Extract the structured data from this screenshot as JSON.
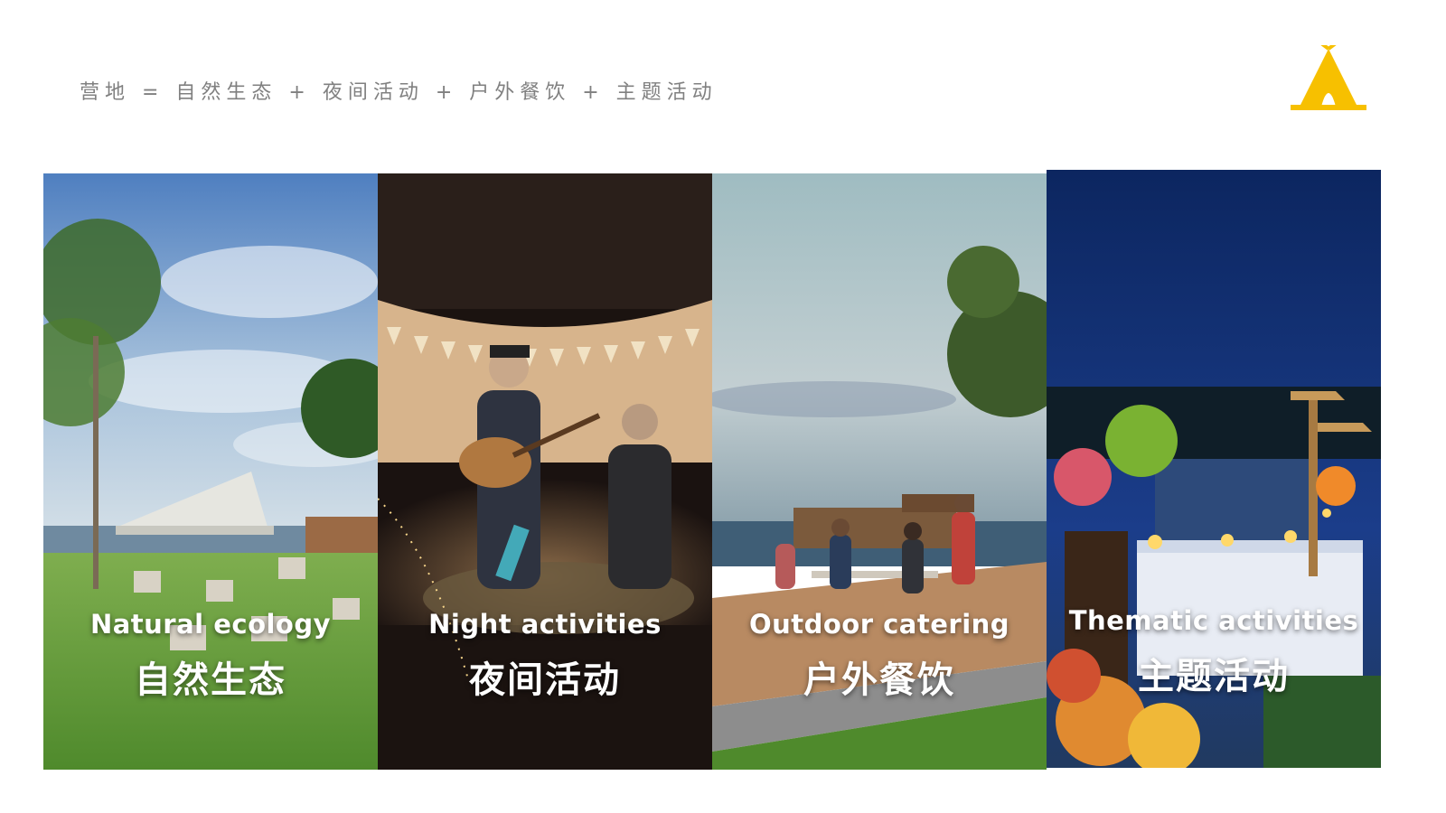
{
  "header": {
    "title": "营地 = 自然生态 + 夜间活动 + 户外餐饮 + 主题活动",
    "logo_icon": "tent-icon",
    "logo_color": "#F7C000"
  },
  "panels": [
    {
      "caption_en": "Natural ecology",
      "caption_zh": "自然生态"
    },
    {
      "caption_en": "Night activities",
      "caption_zh": "夜间活动"
    },
    {
      "caption_en": "Outdoor catering",
      "caption_zh": "户外餐饮"
    },
    {
      "caption_en": "Thematic activities",
      "caption_zh": "主题活动"
    }
  ]
}
